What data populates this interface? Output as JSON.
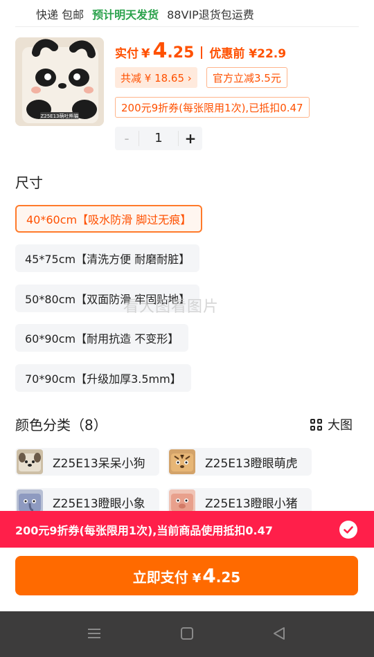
{
  "shipping": {
    "express": "快递 包邮",
    "ship_tomorrow": "预计明天发货",
    "vip": "88VIP退货包运费"
  },
  "product": {
    "image_icon": "panda-doormat-thumbnail",
    "image_caption": "Z25E13萌吐熊猫",
    "pay_label": "实付",
    "currency": "¥",
    "price_int": "4",
    "price_dec": ".25",
    "before_label": "优惠前 ¥22.9",
    "saved_chip": "共减 ¥ 18.65 ›",
    "official_chip": "官方立减3.5元",
    "coupon_chip": "200元9折券(每张限用1次),已抵扣0.47"
  },
  "quantity": {
    "minus": "-",
    "value": "1",
    "plus": "+"
  },
  "size": {
    "title": "尺寸",
    "options": [
      "40*60cm【吸水防滑 脚过无痕】",
      "45*75cm【清洗方便 耐磨耐脏】",
      "50*80cm【双面防滑 牢固贴地】",
      "60*90cm【耐用抗造 不变形】",
      "70*90cm【升级加厚3.5mm】"
    ],
    "selected": "40*60cm【吸水防滑 脚过无痕】"
  },
  "watermark": "看大图看图片",
  "color": {
    "title": "颜色分类（8）",
    "big_pic_label": "大图",
    "big_pic_icon": "grid-icon",
    "options": [
      {
        "label": "Z25E13呆呆小狗",
        "swatch": "#d8cbb6",
        "icon": "dog-swatch-icon"
      },
      {
        "label": "Z25E13瞪眼萌虎",
        "swatch": "#d9b07a",
        "icon": "tiger-swatch-icon"
      },
      {
        "label": "Z25E13瞪眼小象",
        "swatch": "#9aa8c6",
        "icon": "elephant-swatch-icon"
      },
      {
        "label": "Z25E13瞪眼小猪",
        "swatch": "#e7a999",
        "icon": "pig-swatch-icon"
      }
    ]
  },
  "coupon_bar": {
    "text": "200元9折券(每张限用1次),当前商品使用抵扣0.47",
    "check_icon": "check-circle-icon"
  },
  "pay_button": {
    "label": "立即支付",
    "currency": "¥",
    "price_int": "4",
    "price_dec": ".25"
  },
  "colors": {
    "accent": "#ff5000",
    "pay_button": "#ff6a00",
    "coupon_bar": "#ff1f4a",
    "ship_green": "#2ba24c",
    "navbar": "#3d3c3c"
  },
  "system_nav": {
    "menu_icon": "menu-icon",
    "home_icon": "home-square-icon",
    "back_icon": "back-triangle-icon"
  }
}
